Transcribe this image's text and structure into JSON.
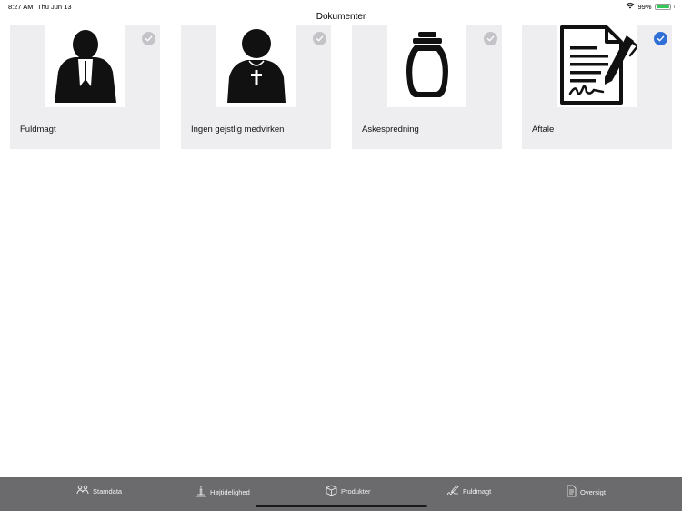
{
  "status": {
    "time": "8:27 AM",
    "date": "Thu Jun 13",
    "battery": "99%",
    "battery_level": 0.99
  },
  "header": {
    "title": "Dokumenter"
  },
  "cards": [
    {
      "label": "Fuldmagt",
      "icon": "priest-icon",
      "selected": false
    },
    {
      "label": "Ingen gejstlig medvirken",
      "icon": "clergy-cross-icon",
      "selected": false
    },
    {
      "label": "Askespredning",
      "icon": "urn-icon",
      "selected": false
    },
    {
      "label": "Aftale",
      "icon": "document-sign-icon",
      "selected": true
    }
  ],
  "tabs": [
    {
      "label": "Stamdata",
      "icon": "people-icon"
    },
    {
      "label": "Højtidelighed",
      "icon": "candle-icon"
    },
    {
      "label": "Produkter",
      "icon": "box-icon"
    },
    {
      "label": "Fuldmagt",
      "icon": "signature-icon"
    },
    {
      "label": "Oversigt",
      "icon": "document-icon"
    }
  ],
  "colors": {
    "accent": "#2f6fd6",
    "card_bg": "#eeeef0",
    "tabbar_bg": "#6b6b6d",
    "check_inactive": "#c4c4c8"
  }
}
